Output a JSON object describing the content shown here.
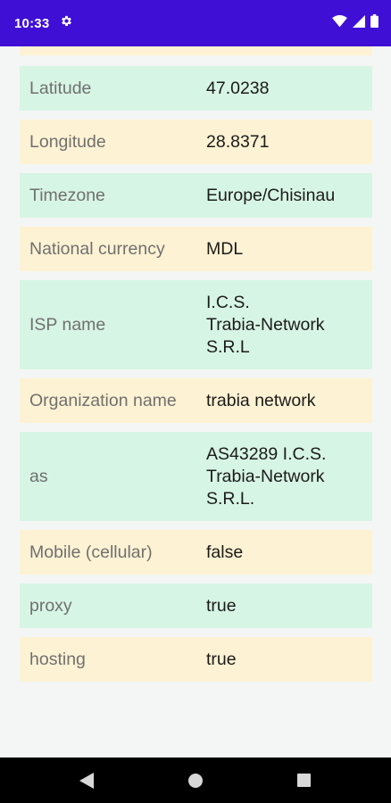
{
  "status_bar": {
    "time": "10:33",
    "icons": [
      "gear-icon",
      "wifi-icon",
      "cellular-signal-icon",
      "battery-icon"
    ],
    "background_color": "#3f0fd6"
  },
  "rows": [
    {
      "label": "",
      "value": "",
      "color": "yellow"
    },
    {
      "label": "Latitude",
      "value": "47.0238",
      "color": "green"
    },
    {
      "label": "Longitude",
      "value": "28.8371",
      "color": "yellow"
    },
    {
      "label": "Timezone",
      "value": "Europe/Chisinau",
      "color": "green"
    },
    {
      "label": "National currency",
      "value": "MDL",
      "color": "yellow"
    },
    {
      "label": "ISP name",
      "value": "I.C.S.\nTrabia-Network\nS.R.L",
      "color": "green"
    },
    {
      "label": "Organization name",
      "value": "trabia network",
      "color": "yellow"
    },
    {
      "label": "as",
      "value": "AS43289 I.C.S.\nTrabia-Network\nS.R.L.",
      "color": "green"
    },
    {
      "label": "Mobile (cellular)",
      "value": "false",
      "color": "yellow"
    },
    {
      "label": "proxy",
      "value": "true",
      "color": "green"
    },
    {
      "label": "hosting",
      "value": "true",
      "color": "yellow"
    }
  ],
  "colors": {
    "row_green": "#d7f5e4",
    "row_yellow": "#fdf2d3",
    "background": "#f4f6f5"
  },
  "nav_bar": {
    "buttons": [
      "back-icon",
      "home-icon",
      "recents-icon"
    ]
  }
}
